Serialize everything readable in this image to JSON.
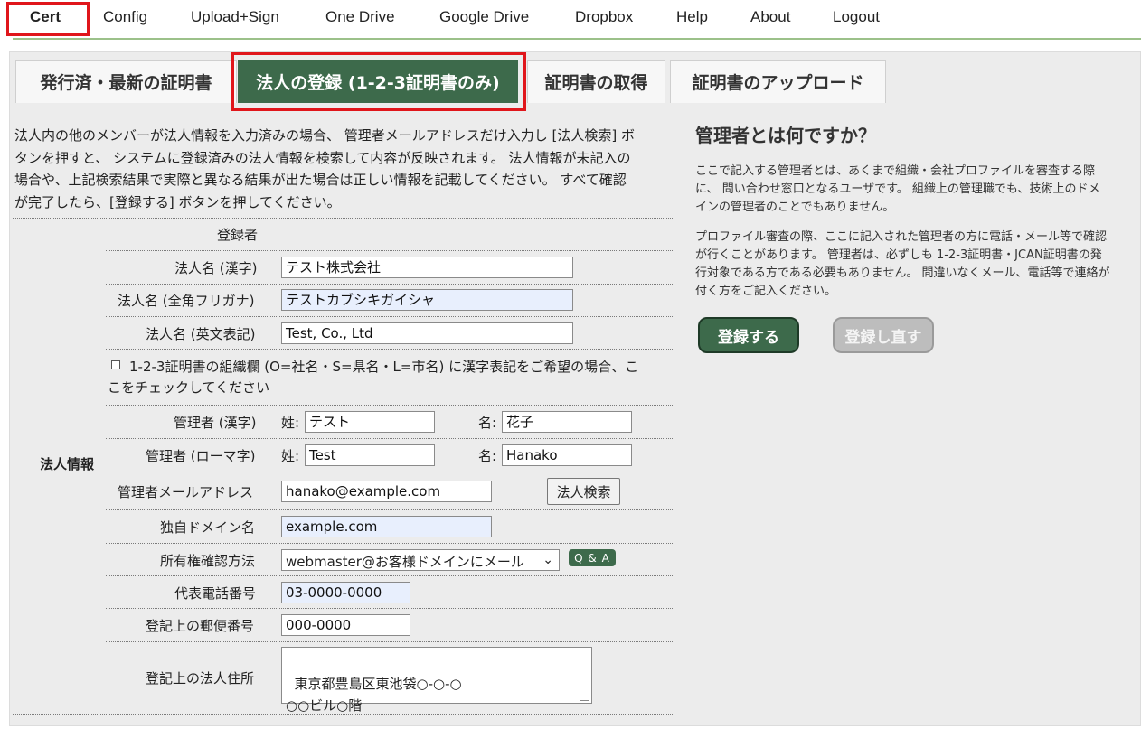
{
  "nav": {
    "items": [
      "Cert",
      "Config",
      "Upload+Sign",
      "One Drive",
      "Google Drive",
      "Dropbox",
      "Help",
      "About",
      "Logout"
    ]
  },
  "tabs": [
    "発行済・最新の証明書",
    "法人の登録 (1-2-3証明書のみ)",
    "証明書の取得",
    "証明書のアップロード"
  ],
  "intro": "法人内の他のメンバーが法人情報を入力済みの場合、 管理者メールアドレスだけ入力し [法人検索] ボタンを押すと、 システムに登録済みの法人情報を検索して内容が反映されます。 法人情報が未記入の場合や、上記検索結果で実際と異なる結果が出た場合は正しい情報を記載してください。 すべて確認が完了したら、[登録する] ボタンを押してください。",
  "form": {
    "section_label": "法人情報",
    "registrant_label": "登録者",
    "name_kanji_label": "法人名 (漢字)",
    "name_kanji_value": "テスト株式会社",
    "name_kana_label": "法人名 (全角フリガナ)",
    "name_kana_value": "テストカブシキガイシャ",
    "name_en_label": "法人名 (英文表記)",
    "name_en_value": "Test, Co., Ltd",
    "kanji_checkbox_label": "1-2-3証明書の組織欄 (O=社名・S=県名・L=市名) に漢字表記をご希望の場合、ここをチェックしてください",
    "kanji_checkbox_checked": false,
    "admin_kanji_label": "管理者 (漢字)",
    "admin_roman_label": "管理者 (ローマ字)",
    "surname_prefix": "姓:",
    "given_prefix": "名:",
    "admin_kanji_surname": "テスト",
    "admin_kanji_given": "花子",
    "admin_roman_surname": "Test",
    "admin_roman_given": "Hanako",
    "admin_email_label": "管理者メールアドレス",
    "admin_email_value": "hanako@example.com",
    "search_button": "法人検索",
    "domain_label": "独自ドメイン名",
    "domain_value": "example.com",
    "verify_label": "所有権確認方法",
    "verify_value": "webmaster@お客様ドメインにメール",
    "qa_button": "Q & A",
    "phone_label": "代表電話番号",
    "phone_value": "03-0000-0000",
    "postal_label": "登記上の郵便番号",
    "postal_value": "000-0000",
    "address_label": "登記上の法人住所",
    "address_value": "東京都豊島区東池袋○-○-○\n○○ビル○階"
  },
  "side": {
    "title": "管理者とは何ですか？",
    "para1": "ここで記入する管理者とは、あくまで組織・会社プロファイルを審査する際に、 問い合わせ窓口となるユーザです。 組織上の管理職でも、技術上のドメインの管理者のことでもありません。",
    "para2": "プロファイル審査の際、ここに記入された管理者の方に電話・メール等で確認が行くことがあります。 管理者は、必ずしも 1-2-3証明書・JCAN証明書の発行対象である方である必要もありません。 間違いなくメール、電話等で連絡が付く方をご記入ください。",
    "register_button": "登録する",
    "reset_button": "登録し直す"
  },
  "colors": {
    "accent_green": "#3d6a4b",
    "highlight_red": "#e0161b",
    "nav_line": "#9cc18a"
  }
}
